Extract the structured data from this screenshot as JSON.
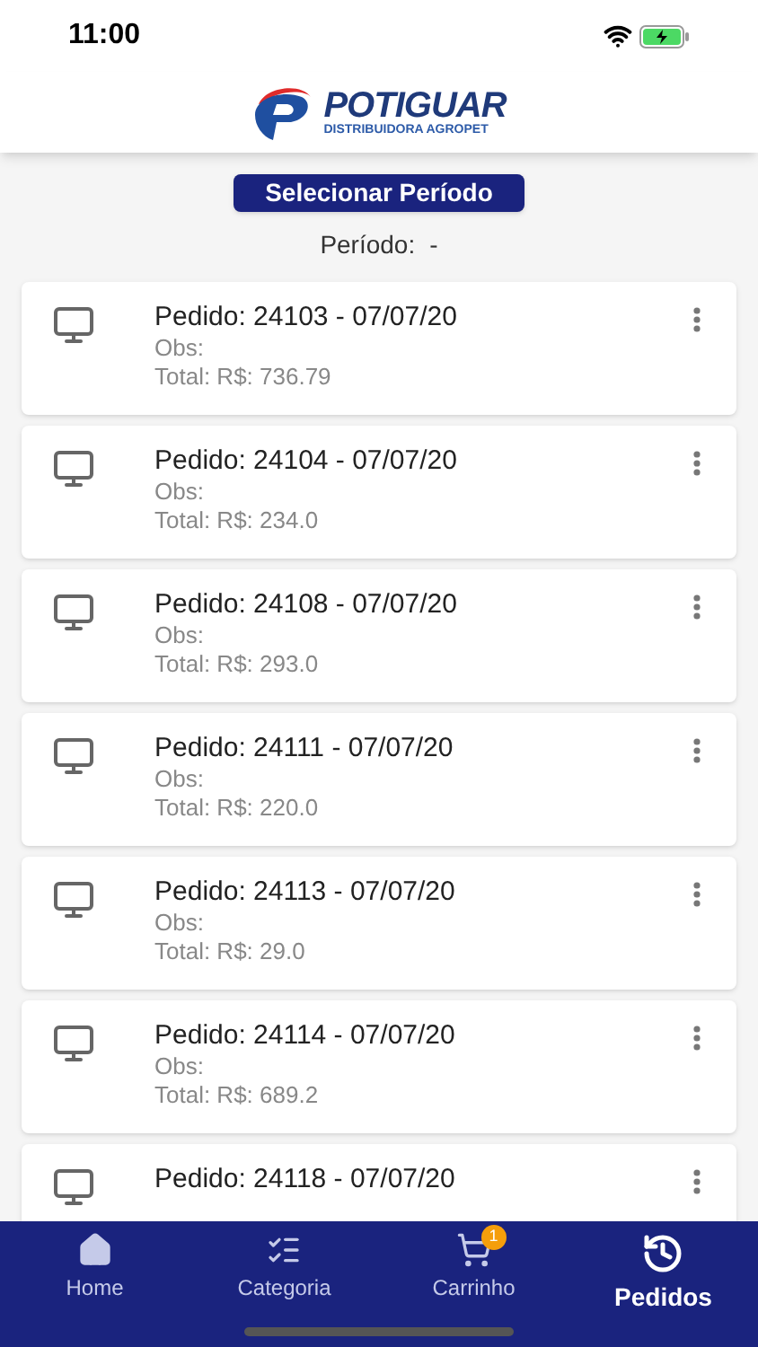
{
  "status_bar": {
    "time": "11:00"
  },
  "header": {
    "brand": "POTIGUAR",
    "tagline": "DISTRIBUIDORA AGROPET"
  },
  "period_button": "Selecionar Período",
  "period": {
    "label": "Período:",
    "value": "-"
  },
  "orders": [
    {
      "title": "Pedido: 24103 - 07/07/20",
      "obs": "Obs:",
      "total": "Total: R$: 736.79"
    },
    {
      "title": "Pedido: 24104 - 07/07/20",
      "obs": "Obs:",
      "total": "Total: R$: 234.0"
    },
    {
      "title": "Pedido: 24108 - 07/07/20",
      "obs": "Obs:",
      "total": "Total: R$: 293.0"
    },
    {
      "title": "Pedido: 24111 - 07/07/20",
      "obs": "Obs:",
      "total": "Total: R$: 220.0"
    },
    {
      "title": "Pedido: 24113 - 07/07/20",
      "obs": "Obs:",
      "total": "Total: R$: 29.0"
    },
    {
      "title": "Pedido: 24114 - 07/07/20",
      "obs": "Obs:",
      "total": "Total: R$: 689.2"
    },
    {
      "title": "Pedido: 24118 - 07/07/20"
    }
  ],
  "tab_bar": [
    {
      "kind": "home",
      "label": "Home",
      "selected": false
    },
    {
      "kind": "category",
      "label": "Categoria",
      "selected": false
    },
    {
      "kind": "cart",
      "label": "Carrinho",
      "selected": false,
      "badge": "1"
    },
    {
      "kind": "orders",
      "label": "Pedidos",
      "selected": true
    }
  ]
}
